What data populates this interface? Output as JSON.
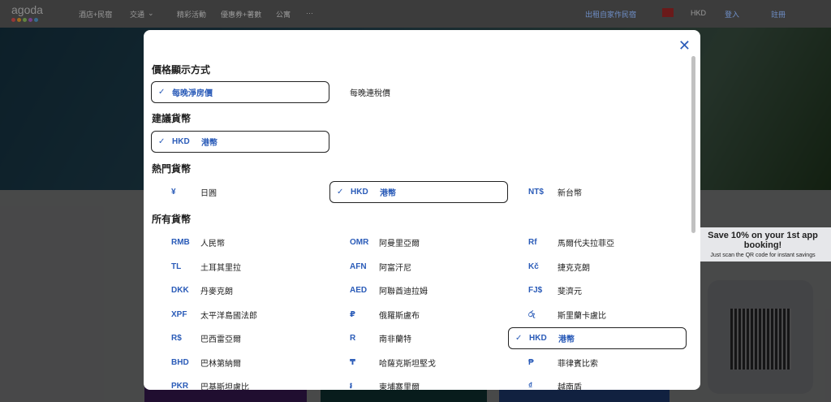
{
  "header": {
    "logo": "agoda",
    "nav": [
      "酒店+民宿",
      "交通",
      "精彩活動",
      "優惠券+著數",
      "公寓",
      "···"
    ],
    "host": "出租自家作民宿",
    "currency": "HKD",
    "login": "登入",
    "register": "註冊"
  },
  "promo": {
    "title": "Save 10% on your 1st app booking!",
    "subtitle": "Just scan the QR code for instant savings"
  },
  "modal": {
    "price_title": "價格顯示方式",
    "price_options": [
      {
        "label": "每晚淨房價",
        "selected": true
      },
      {
        "label": "每晚連稅價",
        "selected": false
      }
    ],
    "suggested_title": "建議貨幣",
    "suggested": [
      {
        "code": "HKD",
        "name": "港幣",
        "selected": true
      }
    ],
    "popular_title": "熱門貨幣",
    "popular": [
      {
        "code": "¥",
        "name": "日圓",
        "selected": false
      },
      {
        "code": "HKD",
        "name": "港幣",
        "selected": true
      },
      {
        "code": "NT$",
        "name": "新台幣",
        "selected": false
      }
    ],
    "all_title": "所有貨幣",
    "all": [
      {
        "code": "RMB",
        "name": "人民幣"
      },
      {
        "code": "OMR",
        "name": "阿曼里亞爾"
      },
      {
        "code": "Rf",
        "name": "馬爾代夫拉菲亞"
      },
      {
        "code": "TL",
        "name": "土耳其里拉"
      },
      {
        "code": "AFN",
        "name": "阿富汗尼"
      },
      {
        "code": "Kč",
        "name": "捷克克朗"
      },
      {
        "code": "DKK",
        "name": "丹麥克朗"
      },
      {
        "code": "AED",
        "name": "阿聯酋迪拉姆"
      },
      {
        "code": "FJ$",
        "name": "斐濟元"
      },
      {
        "code": "XPF",
        "name": "太平洋島國法郎"
      },
      {
        "code": "₽",
        "name": "俄羅斯盧布"
      },
      {
        "code": "රු",
        "name": "斯里蘭卡盧比"
      },
      {
        "code": "R$",
        "name": "巴西雷亞爾"
      },
      {
        "code": "R",
        "name": "南非蘭特"
      },
      {
        "code": "HKD",
        "name": "港幣",
        "selected": true
      },
      {
        "code": "BHD",
        "name": "巴林第納爾"
      },
      {
        "code": "₸",
        "name": "哈薩克斯坦堅戈"
      },
      {
        "code": "₱",
        "name": "菲律賓比索"
      },
      {
        "code": "PKR",
        "name": "巴基斯坦盧比"
      },
      {
        "code": "៛",
        "name": "柬埔寨里爾"
      },
      {
        "code": "₫",
        "name": "越南盾"
      }
    ]
  }
}
